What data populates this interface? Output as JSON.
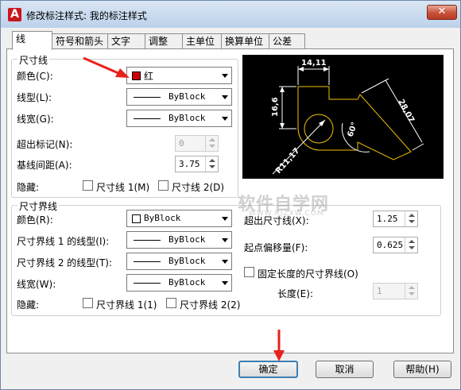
{
  "window": {
    "title": "修改标注样式: 我的标注样式",
    "app_icon": {
      "name": "autocad-icon",
      "glyph": "A",
      "color": "#c9181e"
    },
    "close_glyph": "✕"
  },
  "tabs": [
    {
      "label": "线",
      "active": true
    },
    {
      "label": "符号和箭头",
      "active": false
    },
    {
      "label": "文字",
      "active": false
    },
    {
      "label": "调整",
      "active": false
    },
    {
      "label": "主单位",
      "active": false
    },
    {
      "label": "换算单位",
      "active": false
    },
    {
      "label": "公差",
      "active": false
    }
  ],
  "dim_lines": {
    "caption": "尺寸线",
    "color_label": "颜色(C):",
    "color_value": "红",
    "color_swatch": "#cc0000",
    "linetype_label": "线型(L):",
    "linetype_value": "ByBlock",
    "lineweight_label": "线宽(G):",
    "lineweight_value": "ByBlock",
    "extend_label": "超出标记(N):",
    "extend_value": "0",
    "baseline_label": "基线间距(A):",
    "baseline_value": "3.75",
    "suppress_label": "隐藏:",
    "suppress_1": "尺寸线 1(M)",
    "suppress_2": "尺寸线 2(D)"
  },
  "ext_lines": {
    "caption": "尺寸界线",
    "color_label": "颜色(R):",
    "color_value": "ByBlock",
    "ext1_linetype_label": "尺寸界线 1 的线型(I):",
    "ext1_linetype_value": "ByBlock",
    "ext2_linetype_label": "尺寸界线 2 的线型(T):",
    "ext2_linetype_value": "ByBlock",
    "lineweight_label": "线宽(W):",
    "lineweight_value": "ByBlock",
    "suppress_label": "隐藏:",
    "suppress_1": "尺寸界线 1(1)",
    "suppress_2": "尺寸界线 2(2)",
    "extend_label": "超出尺寸线(X):",
    "extend_value": "1.25",
    "offset_label": "起点偏移量(F):",
    "offset_value": "0.625",
    "fixed_label": "固定长度的尺寸界线(O)",
    "length_label": "长度(E):",
    "length_value": "1"
  },
  "preview": {
    "dim_top": "14,11",
    "dim_left": "16,6",
    "dim_right": "28,07",
    "dim_angle": "60°",
    "dim_radius": "R11,17",
    "colors": {
      "background": "#000000",
      "geometry": "#f2c200",
      "dims": "#ffffff",
      "dimline": "#ff2020"
    }
  },
  "buttons": {
    "ok": "确定",
    "cancel": "取消",
    "help": "帮助(H)"
  },
  "watermark": {
    "text_cn": "软件自学网",
    "text_en": "WWW.RJZXW.COM"
  },
  "annotation_color": "#e8211d"
}
